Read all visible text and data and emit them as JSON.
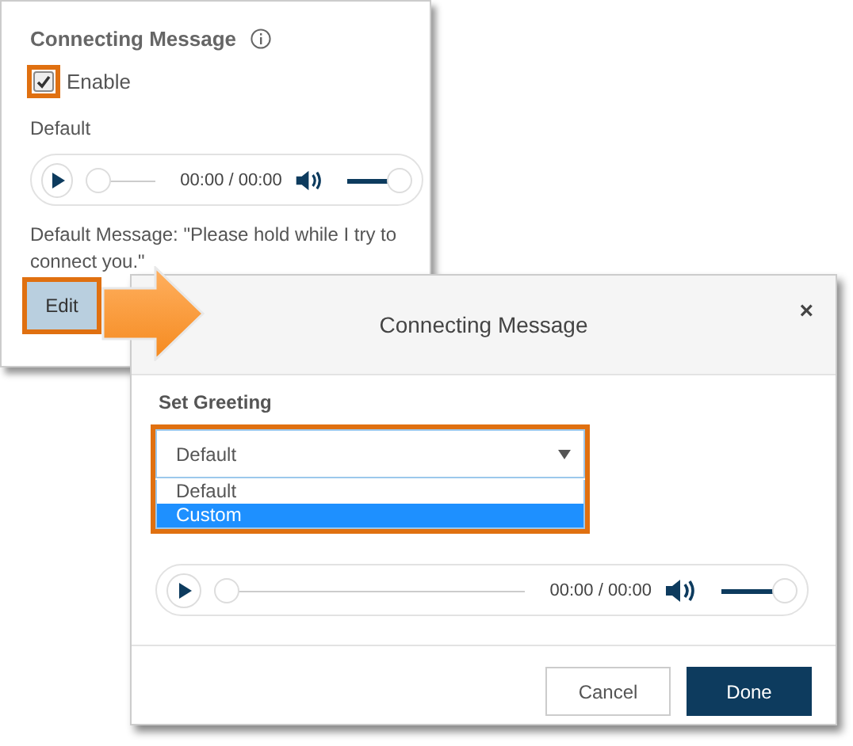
{
  "panel": {
    "title": "Connecting Message",
    "enable": {
      "label": "Enable",
      "checked": true,
      "highlighted": true
    },
    "greeting_label": "Default",
    "player": {
      "progress": {
        "level": 0
      },
      "time": "00:00 / 00:00",
      "volume": {
        "level": 1
      }
    },
    "message": "Default Message: \"Please hold while I try to connect you.\"",
    "edit_button": {
      "label": "Edit",
      "highlighted": true
    }
  },
  "dialog": {
    "title": "Connecting Message",
    "close": "×",
    "field_label": "Set Greeting",
    "select": {
      "value": "Default",
      "expanded": true,
      "highlighted": true,
      "options": [
        {
          "label": "Default",
          "highlighted": false
        },
        {
          "label": "Custom",
          "highlighted": true
        }
      ]
    },
    "player": {
      "progress": {
        "level": 0
      },
      "time": "00:00 / 00:00",
      "volume": {
        "level": 1
      }
    },
    "buttons": [
      {
        "label": "Cancel",
        "kind": "secondary"
      },
      {
        "label": "Done",
        "kind": "primary"
      }
    ]
  }
}
